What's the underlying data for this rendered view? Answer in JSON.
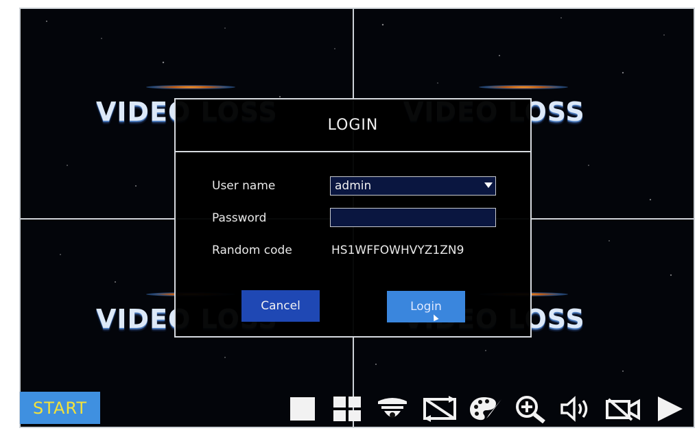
{
  "background": {
    "channel_label": "VIDEO LOSS",
    "colors": {
      "screen_bg": "#03050a",
      "grid": "#cfd3d8"
    }
  },
  "dialog": {
    "title": "LOGIN",
    "fields": {
      "username_label": "User name",
      "username_value": "admin",
      "password_label": "Password",
      "password_value": "",
      "random_code_label": "Random code",
      "random_code_value": "HS1WFFOWHVYZ1ZN9"
    },
    "buttons": {
      "cancel": "Cancel",
      "login": "Login"
    },
    "colors": {
      "cancel_bg": "#1f48b4",
      "login_bg": "#3a86dd",
      "field_bg": "#0a1640"
    }
  },
  "taskbar": {
    "start_label": "START",
    "start_colors": {
      "bg": "#3f90e0",
      "text": "#f4e23a"
    },
    "icons": [
      "single-view-icon",
      "quad-view-icon",
      "ptz-dome-camera-icon",
      "sequence-cycle-icon",
      "color-palette-icon",
      "zoom-in-icon",
      "audio-speaker-icon",
      "record-off-camera-icon",
      "play-icon"
    ]
  }
}
